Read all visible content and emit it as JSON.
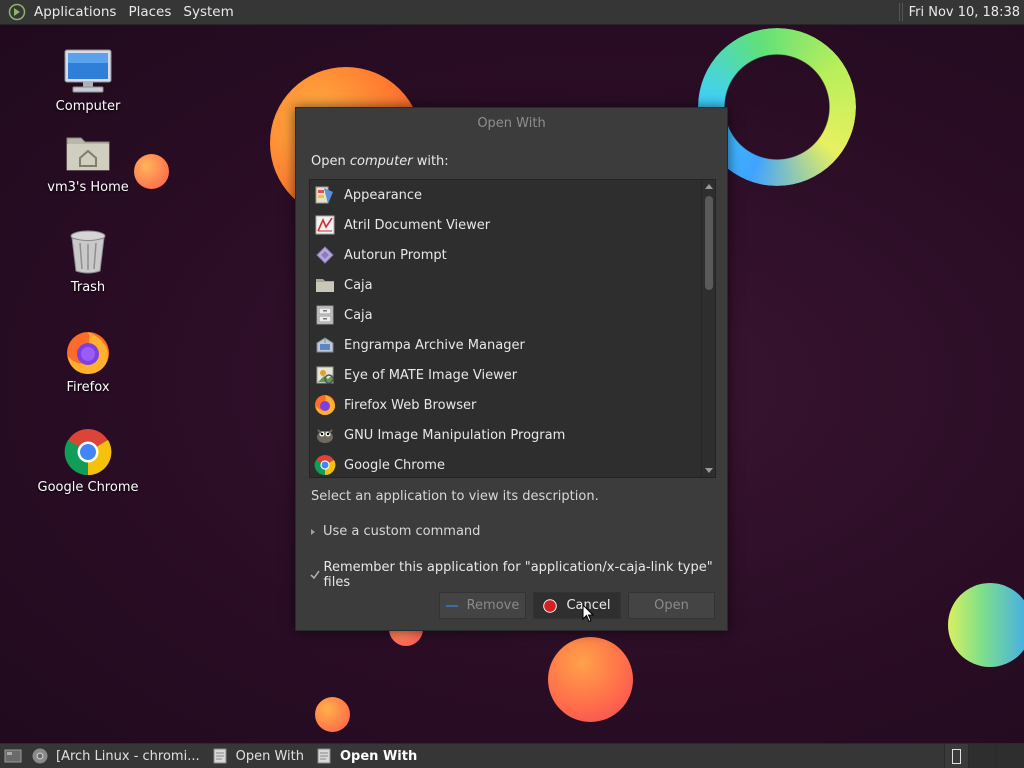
{
  "top_panel": {
    "menus": [
      "Applications",
      "Places",
      "System"
    ],
    "clock": "Fri Nov 10, 18:38"
  },
  "desktop": {
    "icons": [
      {
        "label": "Computer",
        "icon": "computer-icon"
      },
      {
        "label": "vm3's Home",
        "icon": "home-folder-icon"
      },
      {
        "label": "Trash",
        "icon": "trash-icon"
      },
      {
        "label": "Firefox",
        "icon": "firefox-icon"
      },
      {
        "label": "Google Chrome",
        "icon": "chrome-icon"
      }
    ]
  },
  "dialog": {
    "title": "Open With",
    "prompt_prefix": "Open ",
    "prompt_target": "computer",
    "prompt_suffix": " with:",
    "apps": [
      {
        "name": "Appearance",
        "icon": "appearance-icon"
      },
      {
        "name": "Atril Document Viewer",
        "icon": "atril-icon"
      },
      {
        "name": "Autorun Prompt",
        "icon": "autorun-icon"
      },
      {
        "name": "Caja",
        "icon": "folder-icon"
      },
      {
        "name": "Caja",
        "icon": "file-cabinet-icon"
      },
      {
        "name": "Engrampa Archive Manager",
        "icon": "archive-icon"
      },
      {
        "name": "Eye of MATE Image Viewer",
        "icon": "image-viewer-icon"
      },
      {
        "name": "Firefox Web Browser",
        "icon": "firefox-icon"
      },
      {
        "name": "GNU Image Manipulation Program",
        "icon": "gimp-icon"
      },
      {
        "name": "Google Chrome",
        "icon": "chrome-icon"
      }
    ],
    "description": "Select an application to view its description.",
    "custom_command_label": "Use a custom command",
    "remember_label": "Remember this application for \"application/x-caja-link type\" files",
    "remember_checked": true,
    "buttons": {
      "remove": "Remove",
      "cancel": "Cancel",
      "open": "Open"
    }
  },
  "taskbar": {
    "tasks": [
      {
        "label": "[Arch Linux - chromi...",
        "icon": "chrome-icon",
        "active": false
      },
      {
        "label": "Open With",
        "icon": "window-icon",
        "active": false
      },
      {
        "label": "Open With",
        "icon": "window-icon",
        "active": true
      }
    ]
  }
}
